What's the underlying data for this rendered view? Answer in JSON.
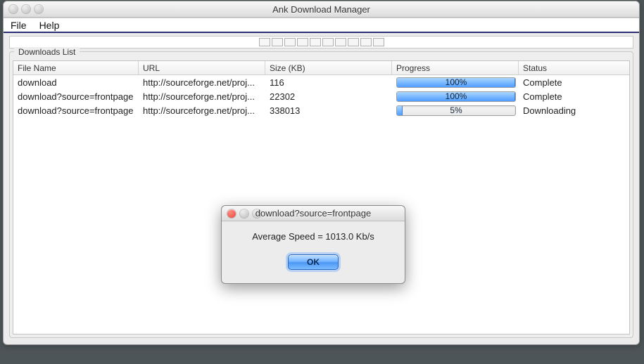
{
  "window": {
    "title": "Ank Download Manager"
  },
  "menubar": {
    "file": "File",
    "help": "Help"
  },
  "group_title": "Downloads List",
  "columns": {
    "name": "File Name",
    "url": "URL",
    "size": "Size (KB)",
    "progress": "Progress",
    "status": "Status"
  },
  "rows": [
    {
      "name": "download",
      "url": "http://sourceforge.net/proj...",
      "size": "116",
      "progress_pct": 100,
      "progress_label": "100%",
      "status": "Complete"
    },
    {
      "name": "download?source=frontpage",
      "url": "http://sourceforge.net/proj...",
      "size": "22302",
      "progress_pct": 100,
      "progress_label": "100%",
      "status": "Complete"
    },
    {
      "name": "download?source=frontpage",
      "url": "http://sourceforge.net/proj...",
      "size": "338013",
      "progress_pct": 5,
      "progress_label": "5%",
      "status": "Downloading"
    }
  ],
  "dialog": {
    "title": "download?source=frontpage",
    "message": "Average Speed = 1013.0 Kb/s",
    "ok": "OK"
  }
}
